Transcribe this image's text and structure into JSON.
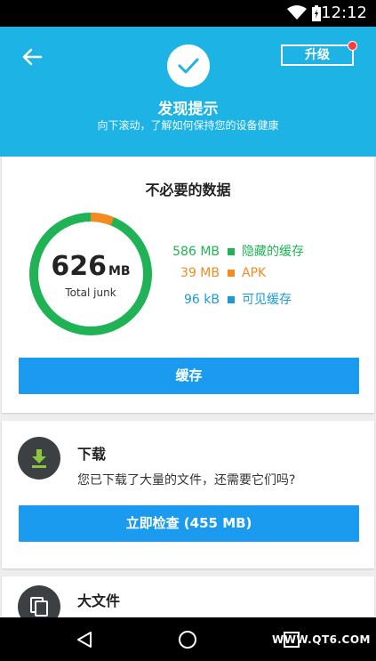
{
  "status_bar": {
    "time": "12:12"
  },
  "header": {
    "title": "发现提示",
    "subtitle": "向下滚动，了解如何保持您的设备健康",
    "upgrade_label": "升级"
  },
  "junk_card": {
    "title": "不必要的数据",
    "total_value": "626",
    "total_unit": "MB",
    "total_label": "Total junk",
    "legend": [
      {
        "size": "586 MB",
        "label": "隐藏的缓存",
        "color": "#1fb356"
      },
      {
        "size": "39 MB",
        "label": "APK",
        "color": "#f58a1f"
      },
      {
        "size": "96 kB",
        "label": "可见缓存",
        "color": "#1c9ad8"
      }
    ],
    "button_label": "缓存"
  },
  "download_card": {
    "title": "下载",
    "description": "您已下载了大量的文件，还需要它们吗?",
    "button_label": "立即检查 (455 MB)"
  },
  "largefile_card": {
    "title": "大文件"
  },
  "nav_bar": {
    "watermark": "WWW.QT6.COM"
  },
  "colors": {
    "header_bg": "#1db3e4",
    "button_bg": "#1a9bf0",
    "ring_green": "#1fb356",
    "ring_orange": "#f58a1f"
  }
}
